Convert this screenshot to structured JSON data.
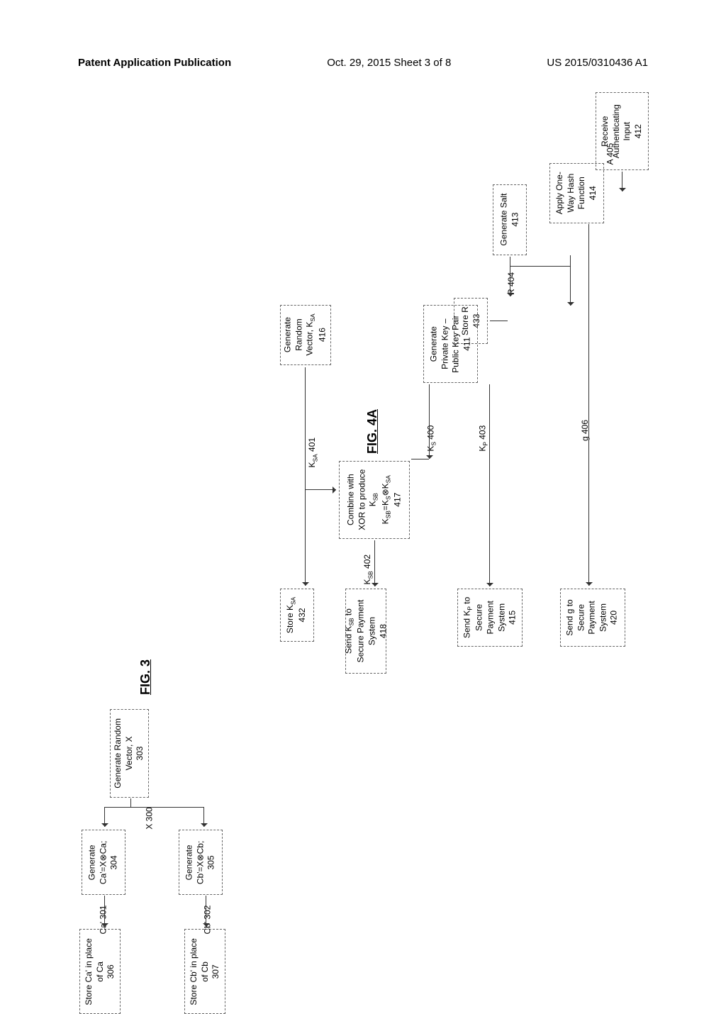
{
  "header": {
    "left": "Patent Application Publication",
    "center": "Oct. 29, 2015  Sheet 3 of 8",
    "right": "US 2015/0310436 A1"
  },
  "fig3": {
    "title": "FIG. 3",
    "boxes": {
      "gen_random": "Generate Random\nVector, X\n303",
      "gen_ca": "Generate\nCa'=X⊗Ca;\n304",
      "gen_cb": "Generate\nCb'=X⊗Cb;\n305",
      "store_ca": "Store Ca' in place\nof Ca\n306",
      "store_cb": "Store Cb' in place\nof Cb\n307"
    },
    "labels": {
      "x300": "X 300",
      "ca301": "Ca' 301",
      "cb302": "Cb' 302"
    }
  },
  "fig4a": {
    "title": "FIG. 4A",
    "boxes": {
      "gen_salt": "Generate Salt\n413",
      "recv_auth": "Receive\nAuthenticating\nInput\n412",
      "store_r": "Store R\n433",
      "apply_hash": "Apply One-\nWay Hash\nFunction\n414",
      "gen_keypair": "Generate\nPrivate Key –\nPublic Key Pair\n411",
      "gen_random_ksa": "Generate\nRandom\nVector, K_SA\n416",
      "store_ksa": "Store K_SA\n432",
      "combine_xor": "Combine with\nXOR to produce\nK_SB\nK_SB=K_S⊗K_SA\n417",
      "send_ksb": "Send K_SB to\nSecure Payment\nSystem\n418",
      "send_kp": "Send K_P to\nSecure\nPayment\nSystem\n415",
      "send_g": "Send g to\nSecure\nPayment\nSystem\n420"
    },
    "labels": {
      "r404": "R 404",
      "a405": "A 405",
      "g406": "g 406",
      "kp403": "K_P 403",
      "ks400": "K_S 400",
      "ksa401": "K_SA 401",
      "ksb402": "K_SB 402"
    }
  }
}
